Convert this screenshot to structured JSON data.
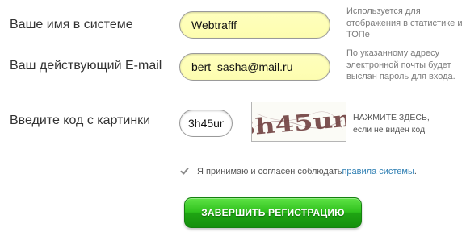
{
  "form": {
    "username": {
      "label": "Ваше имя в системе",
      "value": "Webtrafff",
      "hint": "Используется для отображения в статистике и ТОПе"
    },
    "email": {
      "label": "Ваш действующий E-mail",
      "value": "bert_sasha@mail.ru",
      "hint": "По указанному адресу электронной почты будет выслан пароль для входа."
    },
    "captcha": {
      "label": "Введите код с картинки",
      "value": "3h45un",
      "image_text": "3h45um",
      "refresh_line1": "НАЖМИТЕ ЗДЕСЬ,",
      "refresh_line2": "если не виден код"
    },
    "agreement": {
      "checked": true,
      "text": "Я принимаю и согласен соблюдать ",
      "link_text": "правила системы",
      "suffix": "."
    },
    "submit_label": "ЗАВЕРШИТЬ РЕГИСТРАЦИЮ"
  },
  "icons": {
    "checkbox": "checkmark-icon"
  },
  "colors": {
    "input_bg": "#ffffbd",
    "link": "#2f7fb3",
    "button_green": "#2fc11d",
    "captcha_ink": "#6b3a3a"
  }
}
